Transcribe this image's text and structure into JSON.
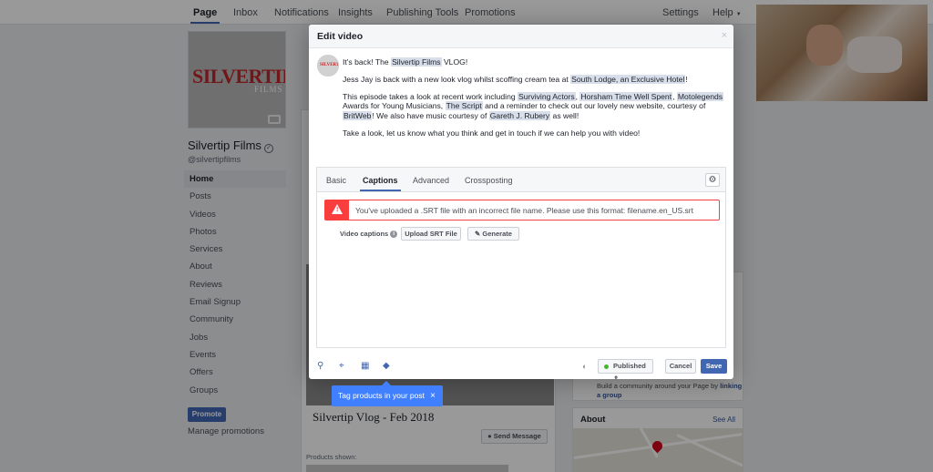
{
  "topnav": {
    "tabs": [
      "Page",
      "Inbox",
      "Notifications",
      "Insights",
      "Publishing Tools",
      "Promotions"
    ],
    "settings": "Settings",
    "help": "Help"
  },
  "page": {
    "logo_text": "SILVERTIP",
    "logo_sub": "FILMS",
    "name": "Silvertip Films",
    "handle": "@silvertipfilms",
    "nav": [
      "Home",
      "Posts",
      "Videos",
      "Photos",
      "Services",
      "About",
      "Reviews",
      "Email Signup",
      "Community",
      "Jobs",
      "Events",
      "Offers",
      "Groups"
    ],
    "promote": "Promote",
    "manage_promotions": "Manage promotions"
  },
  "background_post": {
    "video_title": "Silvertip Vlog - Feb 2018",
    "send_message": "Send Message",
    "products_shown": "Products shown:"
  },
  "right": {
    "build_text": "Build a community around your Page by",
    "build_link": "linking a group",
    "about_title": "About",
    "see_all": "See All"
  },
  "modal": {
    "title": "Edit video",
    "close": "×",
    "post": {
      "p1_a": "It's back! The ",
      "p1_hl": "Silvertip Films",
      "p1_b": " VLOG!",
      "p2_a": "Jess Jay is back with a new look vlog whilst scoffing cream tea at ",
      "p2_hl": "South Lodge, an Exclusive Hotel",
      "p2_b": "!",
      "p3_a": "This episode takes a look at recent work including ",
      "p3_hl1": "Surviving Actors",
      "p3_b": ", ",
      "p3_hl2": "Horsham Time Well Spent",
      "p3_c": ", ",
      "p3_hl3": "Motolegends",
      "p3_d": " Awards for Young Musicians, ",
      "p3_hl4": "The Script",
      "p3_e": " and a reminder to check out our lovely new website, courtesy of ",
      "p3_hl5": "BritWeb",
      "p3_f": "! We also have music courtesy of ",
      "p3_hl6": "Gareth J. Rubery",
      "p3_g": " as well!",
      "p4": "Take a look, let us know what you think and get in touch if we can help you with video!"
    },
    "tabs": [
      "Basic",
      "Captions",
      "Advanced",
      "Crossposting"
    ],
    "active_tab": "Captions",
    "error": "You've uploaded a .SRT file with an incorrect file name. Please use this format: filename.en_US.srt",
    "captions_label": "Video captions",
    "upload_srt": "Upload SRT File",
    "generate": "Generate",
    "published": "Published",
    "cancel": "Cancel",
    "save": "Save"
  },
  "tooltip": {
    "text": "Tag products in your post",
    "close": "×"
  },
  "colors": {
    "brand_blue": "#4267b2",
    "error_red": "#fa3e3e",
    "tooltip_blue": "#4080ff",
    "published_green": "#42b72a"
  }
}
